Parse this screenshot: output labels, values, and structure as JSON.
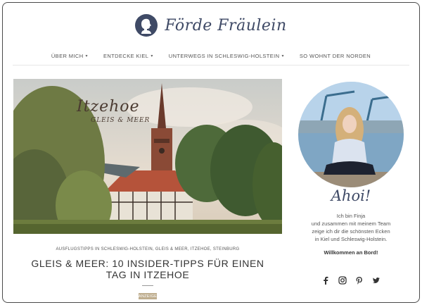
{
  "header": {
    "logo_text": "Förde Fräulein",
    "logo_icon": "silhouette-icon"
  },
  "nav": {
    "items": [
      {
        "label": "ÜBER MICH",
        "has_dropdown": true
      },
      {
        "label": "ENTDECKE KIEL",
        "has_dropdown": true
      },
      {
        "label": "UNTERWEGS IN SCHLESWIG-HOLSTEIN",
        "has_dropdown": true
      },
      {
        "label": "SO WOHNT DER NORDEN",
        "has_dropdown": false
      }
    ]
  },
  "post": {
    "image_title": "Itzehoe",
    "image_subtitle": "GLEIS & MEER",
    "categories": "AUSFLUGSTIPPS IN SCHLESWIG-HOLSTEIN, GLEIS & MEER, ITZEHOE, STEINBURG",
    "title": "GLEIS & MEER: 10 INSIDER-TIPPS FÜR EINEN TAG IN ITZEHOE",
    "badge": "ANZEIGE"
  },
  "sidebar": {
    "greeting": "Ahoi!",
    "intro_lines": [
      "Ich bin Finja",
      "und zusammen mit meinem Team",
      "zeige ich dir die schönsten Ecken",
      "in Kiel und Schleswig-Holstein."
    ],
    "welcome": "Willkommen an Bord!",
    "social": [
      "facebook-icon",
      "instagram-icon",
      "pinterest-icon",
      "twitter-icon"
    ]
  },
  "colors": {
    "brand": "#3f4a66",
    "badge": "#bfae8f"
  }
}
